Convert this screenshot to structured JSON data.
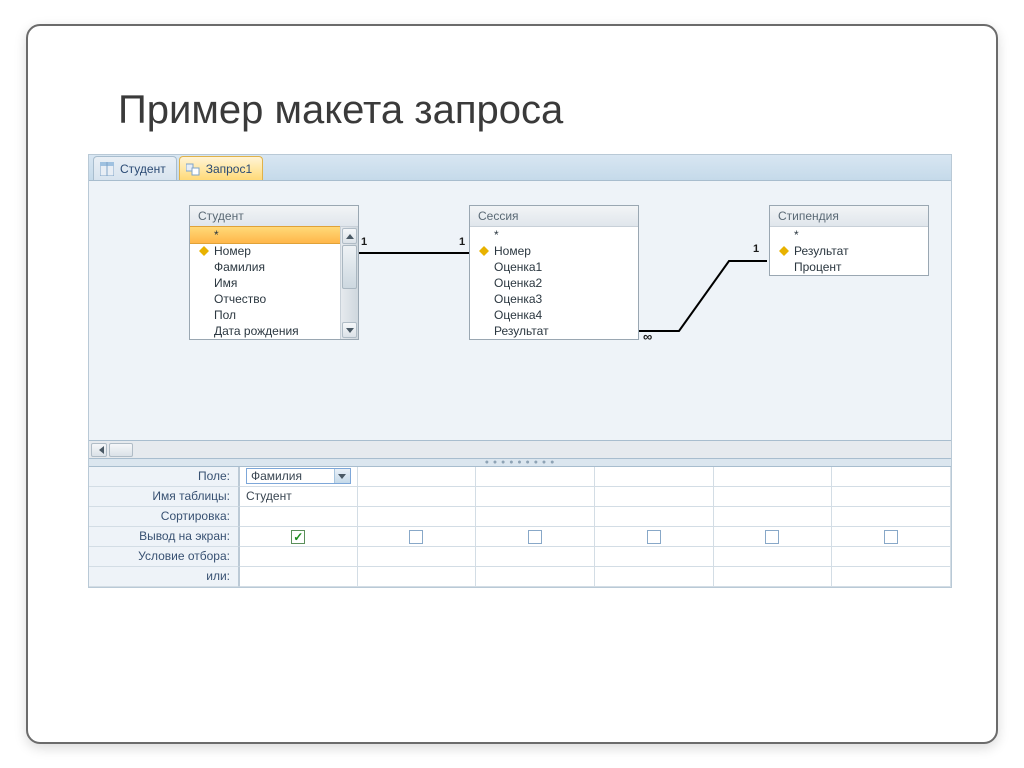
{
  "slide": {
    "title": "Пример макета запроса"
  },
  "tabs": [
    {
      "label": "Студент",
      "active": false
    },
    {
      "label": "Запрос1",
      "active": true
    }
  ],
  "tables": {
    "student": {
      "title": "Студент",
      "fields": [
        "*",
        "Номер",
        "Фамилия",
        "Имя",
        "Отчество",
        "Пол",
        "Дата рождения"
      ],
      "keys": [
        "Номер"
      ],
      "selected": "*",
      "has_scrollbar": true
    },
    "session": {
      "title": "Сессия",
      "fields": [
        "*",
        "Номер",
        "Оценка1",
        "Оценка2",
        "Оценка3",
        "Оценка4",
        "Результат"
      ],
      "keys": [
        "Номер"
      ]
    },
    "stipend": {
      "title": "Стипендия",
      "fields": [
        "*",
        "Результат",
        "Процент"
      ],
      "keys": [
        "Результат"
      ]
    }
  },
  "relations": {
    "r1": {
      "left_label": "1",
      "right_label": "1"
    },
    "r2": {
      "left_label": "∞",
      "right_label": "1"
    }
  },
  "grid": {
    "labels": {
      "field": "Поле:",
      "table": "Имя таблицы:",
      "sort": "Сортировка:",
      "show": "Вывод на экран:",
      "criteria": "Условие отбора:",
      "or": "или:"
    },
    "col1": {
      "field": "Фамилия",
      "table": "Студент",
      "show": true
    },
    "show_default": false
  }
}
